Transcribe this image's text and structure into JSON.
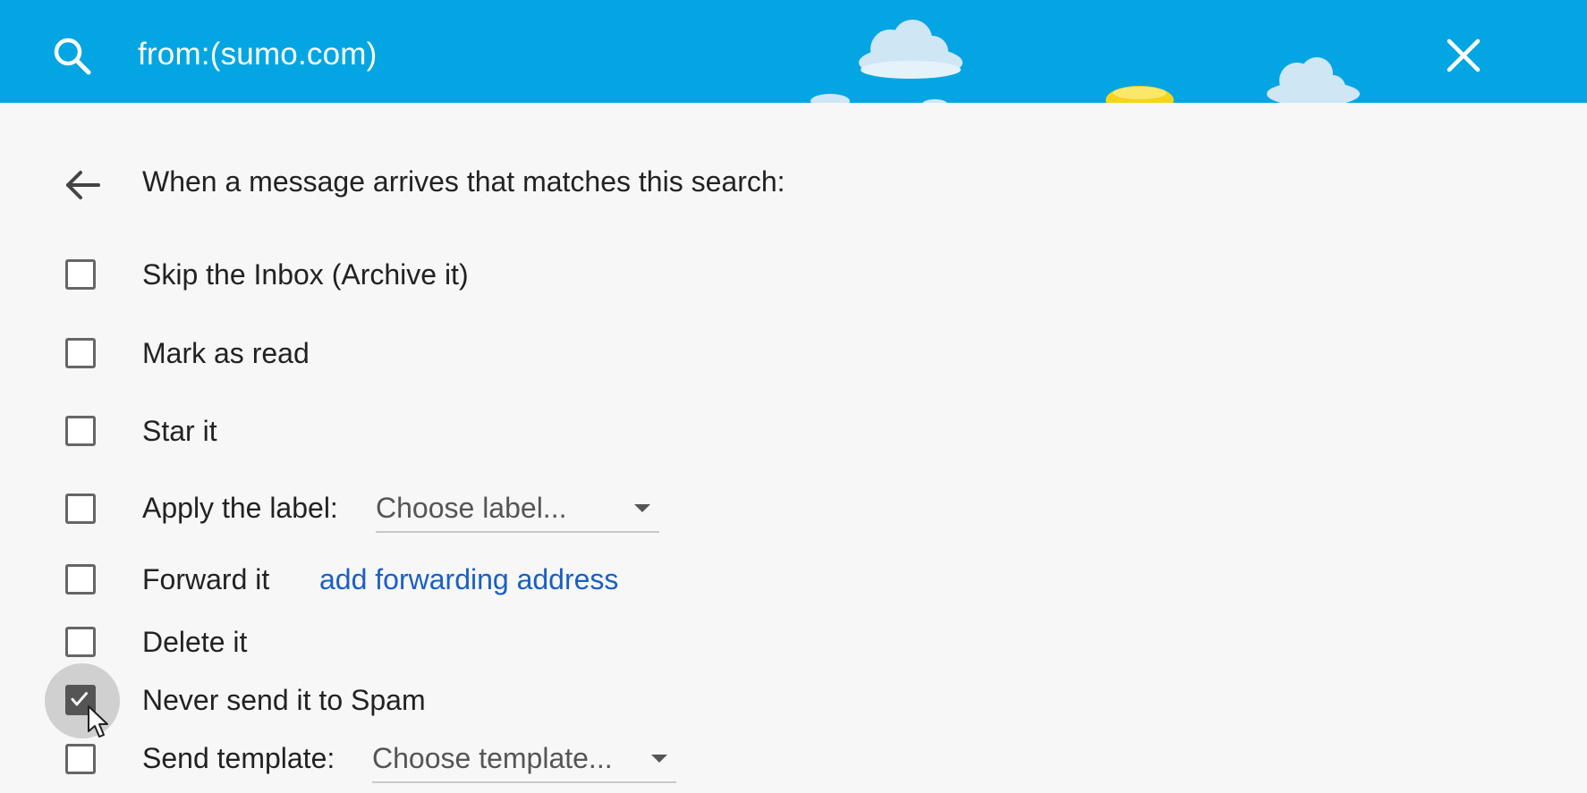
{
  "search": {
    "query": "from:(sumo.com)"
  },
  "colors": {
    "header_bg": "#03a6e2",
    "link": "#1a5fc4",
    "checkbox_checked": "#555555"
  },
  "filter": {
    "heading": "When a message arrives that matches this search:",
    "options": [
      {
        "label": "Skip the Inbox (Archive it)",
        "checked": false
      },
      {
        "label": "Mark as read",
        "checked": false
      },
      {
        "label": "Star it",
        "checked": false
      },
      {
        "label": "Apply the label:",
        "checked": false,
        "dropdown": "Choose label..."
      },
      {
        "label": "Forward it",
        "checked": false,
        "link": "add forwarding address"
      },
      {
        "label": "Delete it",
        "checked": false
      },
      {
        "label": "Never send it to Spam",
        "checked": true
      },
      {
        "label": "Send template:",
        "checked": false,
        "dropdown": "Choose template..."
      }
    ]
  }
}
